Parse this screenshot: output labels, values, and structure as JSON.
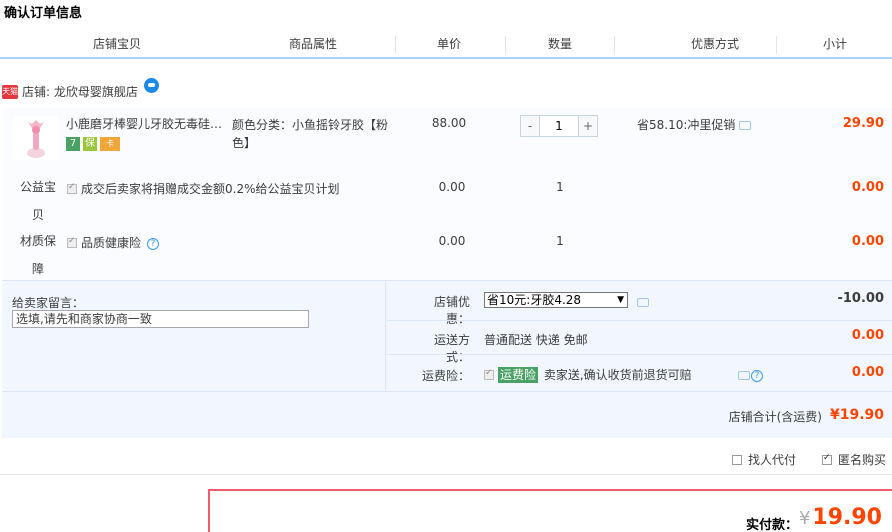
{
  "title": "确认订单信息",
  "columns": [
    "店铺宝贝",
    "商品属性",
    "单价",
    "数量",
    "优惠方式",
    "小计"
  ],
  "shop": {
    "badge": "天猫",
    "label": "店铺: 龙欣母婴旗舰店"
  },
  "item": {
    "name": "小鹿磨牙棒婴儿牙胶无毒硅…",
    "badges": [
      "7",
      "保",
      "卡"
    ],
    "attr": "颜色分类：小鱼摇铃牙胶【粉色】",
    "price": "88.00",
    "qty_minus": "-",
    "qty": "1",
    "qty_plus": "+",
    "promo": "省58.10:冲里促销",
    "subtotal": "29.90"
  },
  "services": [
    {
      "label": "公益宝贝",
      "desc": "成交后卖家将捐赠成交金额0.2%给公益宝贝计划",
      "price": "0.00",
      "qty": "1",
      "total": "0.00"
    },
    {
      "label": "材质保障",
      "desc": "品质健康险",
      "price": "0.00",
      "qty": "1",
      "total": "0.00"
    }
  ],
  "memo": {
    "label": "给卖家留言：",
    "placeholder": "选填,请先和商家协商一致"
  },
  "options": {
    "coupon_label": "店铺优惠：",
    "coupon_value": "省10元:牙胶4.28",
    "coupon_amount": "-10.00",
    "shipping_label": "运送方式：",
    "shipping_value": "普通配送 快递 免邮",
    "shipping_amount": "0.00",
    "insurance_label": "运费险：",
    "insurance_tag": "运费险",
    "insurance_desc": "卖家送,确认收货前退货可赔",
    "insurance_amount": "0.00"
  },
  "shop_total": {
    "label": "店铺合计(含运费)",
    "value": "¥19.90"
  },
  "checkboxes": [
    {
      "label": "找人代付",
      "checked": false
    },
    {
      "label": "匿名购买",
      "checked": true
    }
  ],
  "payment": {
    "label": "实付款：",
    "currency": "¥",
    "value": "19.90"
  },
  "colors": {
    "price_red": "#ff4400",
    "header_line": "#b2d1ff",
    "pay_border": "#f25a6e"
  }
}
